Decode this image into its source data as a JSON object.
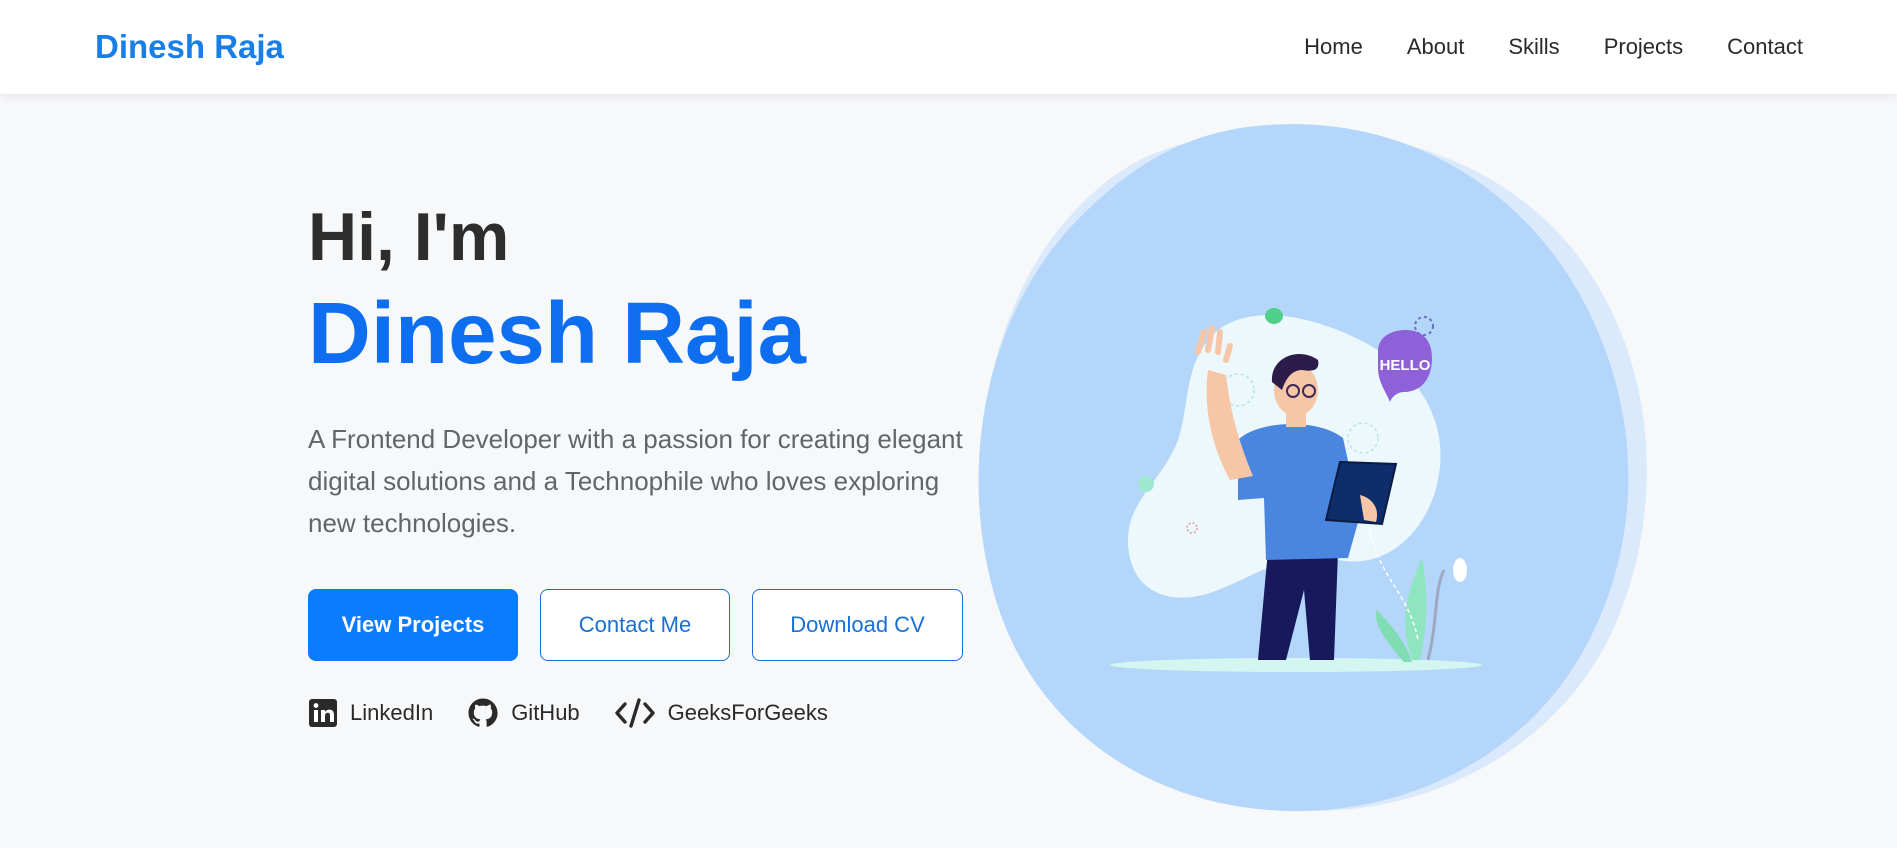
{
  "nav": {
    "brand": "Dinesh Raja",
    "links": [
      "Home",
      "About",
      "Skills",
      "Projects",
      "Contact"
    ]
  },
  "hero": {
    "greeting": "Hi, I'm",
    "name": "Dinesh Raja",
    "description": "A Frontend Developer with a passion for creating elegant digital solutions and a Technophile who loves exploring new technologies.",
    "buttons": {
      "view_projects": "View Projects",
      "contact_me": "Contact Me",
      "download_cv": "Download CV"
    },
    "socials": [
      {
        "label": "LinkedIn",
        "icon": "linkedin-icon"
      },
      {
        "label": "GitHub",
        "icon": "github-icon"
      },
      {
        "label": "GeeksForGeeks",
        "icon": "code-icon"
      }
    ],
    "illustration": {
      "bubble_text": "HELLO"
    }
  },
  "colors": {
    "brand": "#1a7ee8",
    "accent": "#0b7bff",
    "name_blue": "#0d6ef0",
    "blob": "#b3d6fa"
  }
}
